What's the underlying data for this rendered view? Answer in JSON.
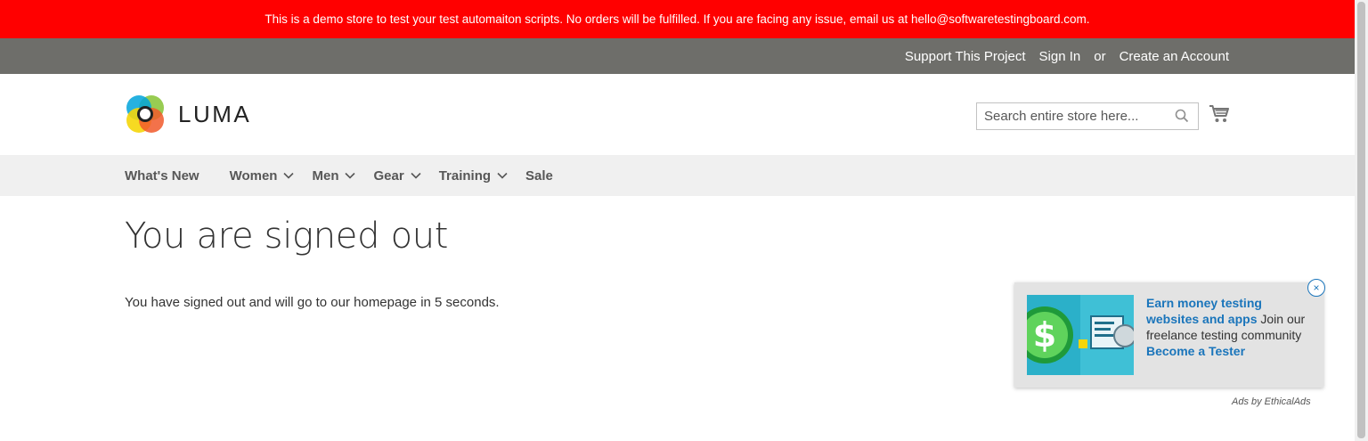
{
  "demo_notice": "This is a demo store to test your test automaiton scripts. No orders will be fulfilled. If you are facing any issue, email us at hello@softwaretestingboard.com.",
  "top_links": {
    "support": "Support This Project",
    "sign_in": "Sign In",
    "or": "or",
    "create_account": "Create an Account"
  },
  "logo": {
    "text": "LUMA"
  },
  "search": {
    "placeholder": "Search entire store here..."
  },
  "nav": {
    "items": [
      {
        "label": "What's New"
      },
      {
        "label": "Women"
      },
      {
        "label": "Men"
      },
      {
        "label": "Gear"
      },
      {
        "label": "Training"
      },
      {
        "label": "Sale"
      }
    ]
  },
  "main": {
    "title": "You are signed out",
    "message": "You have signed out and will go to our homepage in 5 seconds."
  },
  "ad": {
    "close": "×",
    "headline": "Earn money testing websites and apps",
    "body": " Join our freelance testing community ",
    "cta": "Become a Tester",
    "attribution": "Ads by EthicalAds"
  },
  "colors": {
    "demo_bar": "#ff0000",
    "top_bar": "#6e6e6a",
    "nav_bg": "#f0f0f0",
    "ad_link": "#1a75bb"
  }
}
